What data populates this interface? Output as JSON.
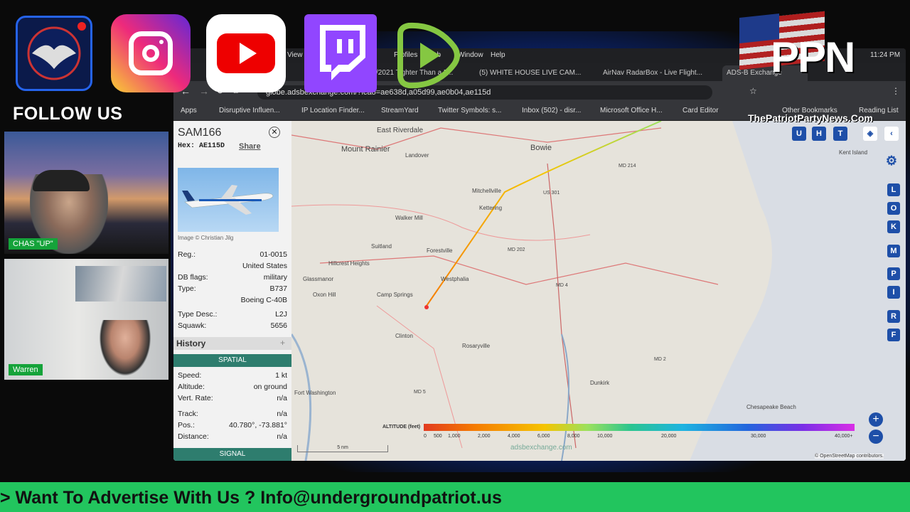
{
  "overlay": {
    "follow_label": "FOLLOW US",
    "cam1_label": "CHAS \"UP\"",
    "cam2_label": "Warren",
    "ppn_logo": "PPN",
    "ppn_site": "ThePatriotPartyNews.Com",
    "banner": "> Want To Advertise With Us ? Info@undergroundpatriot.us",
    "clock": "11:24 PM"
  },
  "menubar": [
    "View",
    "Profiles",
    "Tab",
    "Window",
    "Help"
  ],
  "tabs": [
    {
      "label": "09/23/2021 Tighter Than a F...",
      "active": false
    },
    {
      "label": "(5) WHITE HOUSE LIVE CAM...",
      "active": false
    },
    {
      "label": "AirNav RadarBox - Live Flight...",
      "active": false
    },
    {
      "label": "ADS-B Exchange",
      "active": true
    }
  ],
  "url": "globe.adsbexchange.com/?icao=ae638d,a05d99,ae0b04,ae115d",
  "bookmarks": [
    "Apps",
    "Disruptive Influen...",
    "IP Location Finder...",
    "StreamYard",
    "Twitter Symbols: s...",
    "Inbox (502) - disr...",
    "Microsoft Office H...",
    "Card Editor",
    "Other Bookmarks",
    "Reading List"
  ],
  "aircraft": {
    "callsign": "SAM166",
    "hex_label": "Hex:",
    "hex": "AE115D",
    "share": "Share",
    "image_credit": "Image © Christian Jilg",
    "fields": [
      {
        "k": "Reg.:",
        "v": "01-0015"
      },
      {
        "k": "",
        "v": "United States"
      },
      {
        "k": "DB flags:",
        "v": "military"
      },
      {
        "k": "Type:",
        "v": "B737"
      },
      {
        "k": "",
        "v": "Boeing C-40B"
      },
      {
        "k": "Type Desc.:",
        "v": "L2J"
      },
      {
        "k": "Squawk:",
        "v": "5656"
      }
    ],
    "history": "History",
    "spatial": "SPATIAL",
    "spatial_fields": [
      {
        "k": "Speed:",
        "v": "1 kt"
      },
      {
        "k": "Altitude:",
        "v": "on ground"
      },
      {
        "k": "Vert. Rate:",
        "v": "n/a"
      },
      {
        "k": "Track:",
        "v": "n/a"
      },
      {
        "k": "Pos.:",
        "v": "40.780°, -73.881°"
      },
      {
        "k": "Distance:",
        "v": "n/a"
      }
    ],
    "signal": "SIGNAL"
  },
  "map": {
    "towns": [
      "East Riverdale",
      "Mount Rainier",
      "Landover",
      "Bowie",
      "Mitchellville",
      "Kettering",
      "Walker Mill",
      "Suitland",
      "Forestville",
      "Hillcrest Heights",
      "Westphalia",
      "Glassmanor",
      "Camp Springs",
      "Oxon Hill",
      "Clinton",
      "Rosaryville",
      "Fort Washington",
      "Kent Island",
      "Chesapeake Beach",
      "Dunkirk",
      "MD 214",
      "US 301",
      "MD 202",
      "MD 4",
      "MD 2",
      "MD 5"
    ],
    "buttons_top": [
      "U",
      "H",
      "T"
    ],
    "buttons_side": [
      "L",
      "O",
      "K",
      "M",
      "P",
      "I",
      "R",
      "F"
    ],
    "altitude_label": "ALTITUDE (feet)",
    "altitude_ticks": [
      "0",
      "500",
      "1,000",
      "2,000",
      "4,000",
      "6,000",
      "8,000",
      "10,000",
      "20,000",
      "30,000",
      "40,000+"
    ],
    "scale": "5 nm",
    "watermark": "adsbexchange.com",
    "attribution": "© OpenStreetMap contributors.",
    "zoom_in": "+",
    "zoom_out": "−"
  },
  "colors": {
    "accent": "#1e4fa8",
    "banner": "#22c55e",
    "camlabel": "#15a33a"
  }
}
